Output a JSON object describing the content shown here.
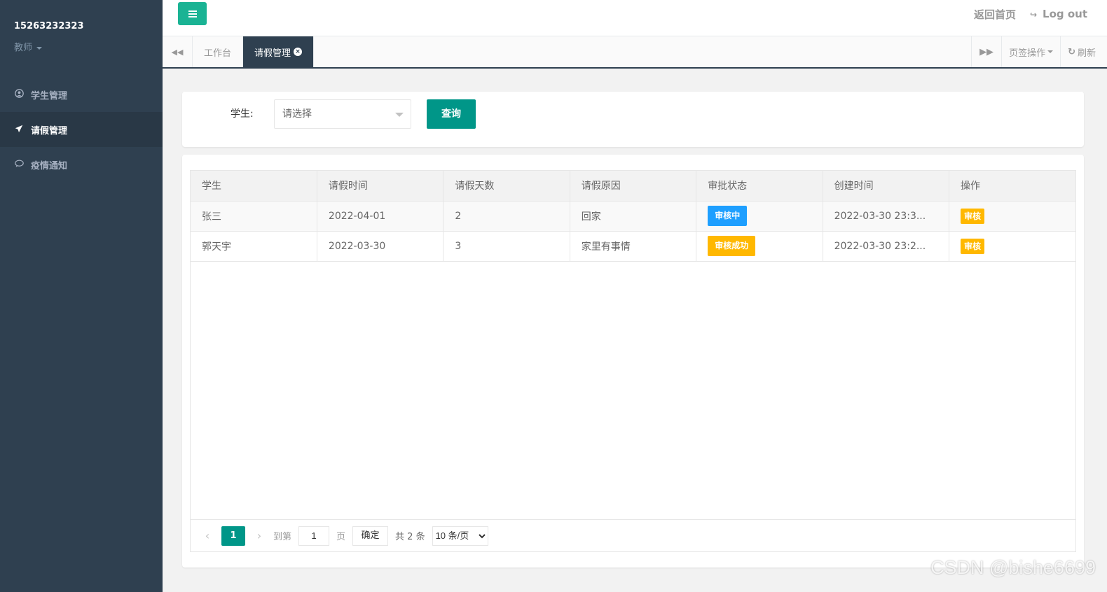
{
  "sidebar": {
    "user": "15263232323",
    "role": "教师",
    "items": [
      {
        "label": "学生管理",
        "icon": "user-circle-icon"
      },
      {
        "label": "请假管理",
        "icon": "paper-plane-icon"
      },
      {
        "label": "疫情通知",
        "icon": "comment-icon"
      }
    ]
  },
  "topbar": {
    "home_link": "返回首页",
    "logout": "Log out"
  },
  "tabs": {
    "items": [
      {
        "label": "工作台"
      },
      {
        "label": "请假管理"
      }
    ],
    "tab_ops": "页签操作",
    "refresh": "刷新"
  },
  "search": {
    "label": "学生:",
    "placeholder": "请选择",
    "query_button": "查询"
  },
  "table": {
    "columns": [
      "学生",
      "请假时间",
      "请假天数",
      "请假原因",
      "审批状态",
      "创建时间",
      "操作"
    ],
    "rows": [
      {
        "student": "张三",
        "date": "2022-04-01",
        "days": "2",
        "reason": "回家",
        "status": "审核中",
        "status_color": "#1e9fff",
        "created": "2022-03-30 23:3...",
        "action": "审核"
      },
      {
        "student": "郭天宇",
        "date": "2022-03-30",
        "days": "3",
        "reason": "家里有事情",
        "status": "审核成功",
        "status_color": "#ffb800",
        "created": "2022-03-30 23:2...",
        "action": "审核"
      }
    ]
  },
  "pager": {
    "current": "1",
    "goto_label": "到第",
    "goto_value": "1",
    "page_label": "页",
    "ok": "确定",
    "total": "共 2 条",
    "limit": "10 条/页"
  },
  "watermark": "CSDN @bishe6699",
  "colors": {
    "sidebar_bg": "#2f4050",
    "accent": "#009688",
    "menu_btn": "#1ab394",
    "status_pending": "#1e9fff",
    "status_success": "#ffb800"
  }
}
